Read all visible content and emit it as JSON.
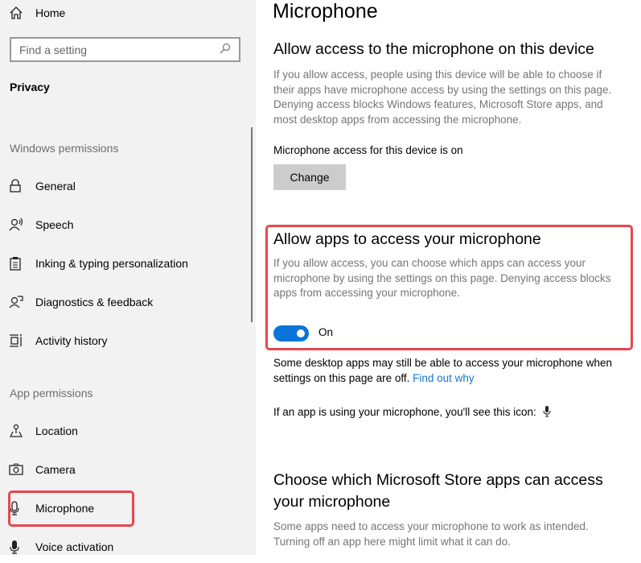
{
  "sidebar": {
    "home": "Home",
    "search_placeholder": "Find a setting",
    "category": "Privacy",
    "windows_permissions": "Windows permissions",
    "windows_items": [
      {
        "label": "General",
        "icon": "lock-icon"
      },
      {
        "label": "Speech",
        "icon": "speech-icon"
      },
      {
        "label": "Inking & typing personalization",
        "icon": "clipboard-icon"
      },
      {
        "label": "Diagnostics & feedback",
        "icon": "feedback-icon"
      },
      {
        "label": "Activity history",
        "icon": "timeline-icon"
      }
    ],
    "app_permissions": "App permissions",
    "app_items": [
      {
        "label": "Location",
        "icon": "location-icon"
      },
      {
        "label": "Camera",
        "icon": "camera-icon"
      },
      {
        "label": "Microphone",
        "icon": "microphone-icon",
        "selected": true
      },
      {
        "label": "Voice activation",
        "icon": "microphone-filled-icon"
      }
    ]
  },
  "main": {
    "title": "Microphone",
    "device": {
      "heading": "Allow access to the microphone on this device",
      "description": "If you allow access, people using this device will be able to choose if their apps have microphone access by using the settings on this page. Denying access blocks Windows features, Microsoft Store apps, and most desktop apps from accessing the microphone.",
      "status": "Microphone access for this device is on",
      "change_label": "Change"
    },
    "apps": {
      "heading": "Allow apps to access your microphone",
      "description": "If you allow access, you can choose which apps can access your microphone by using the settings on this page. Denying access blocks apps from accessing your microphone.",
      "toggle_state": "On",
      "toggle_on": true
    },
    "desktop_note": "Some desktop apps may still be able to access your microphone when settings on this page are off.",
    "find_out_why": "Find out why",
    "icon_note": "If an app is using your microphone, you'll see this icon:",
    "store": {
      "heading": "Choose which Microsoft Store apps can access your microphone",
      "description": "Some apps need to access your microphone to work as intended. Turning off an app here might limit what it can do."
    }
  },
  "colors": {
    "accent": "#0a74d9",
    "highlight": "#e8474d",
    "link": "#1479c8"
  }
}
